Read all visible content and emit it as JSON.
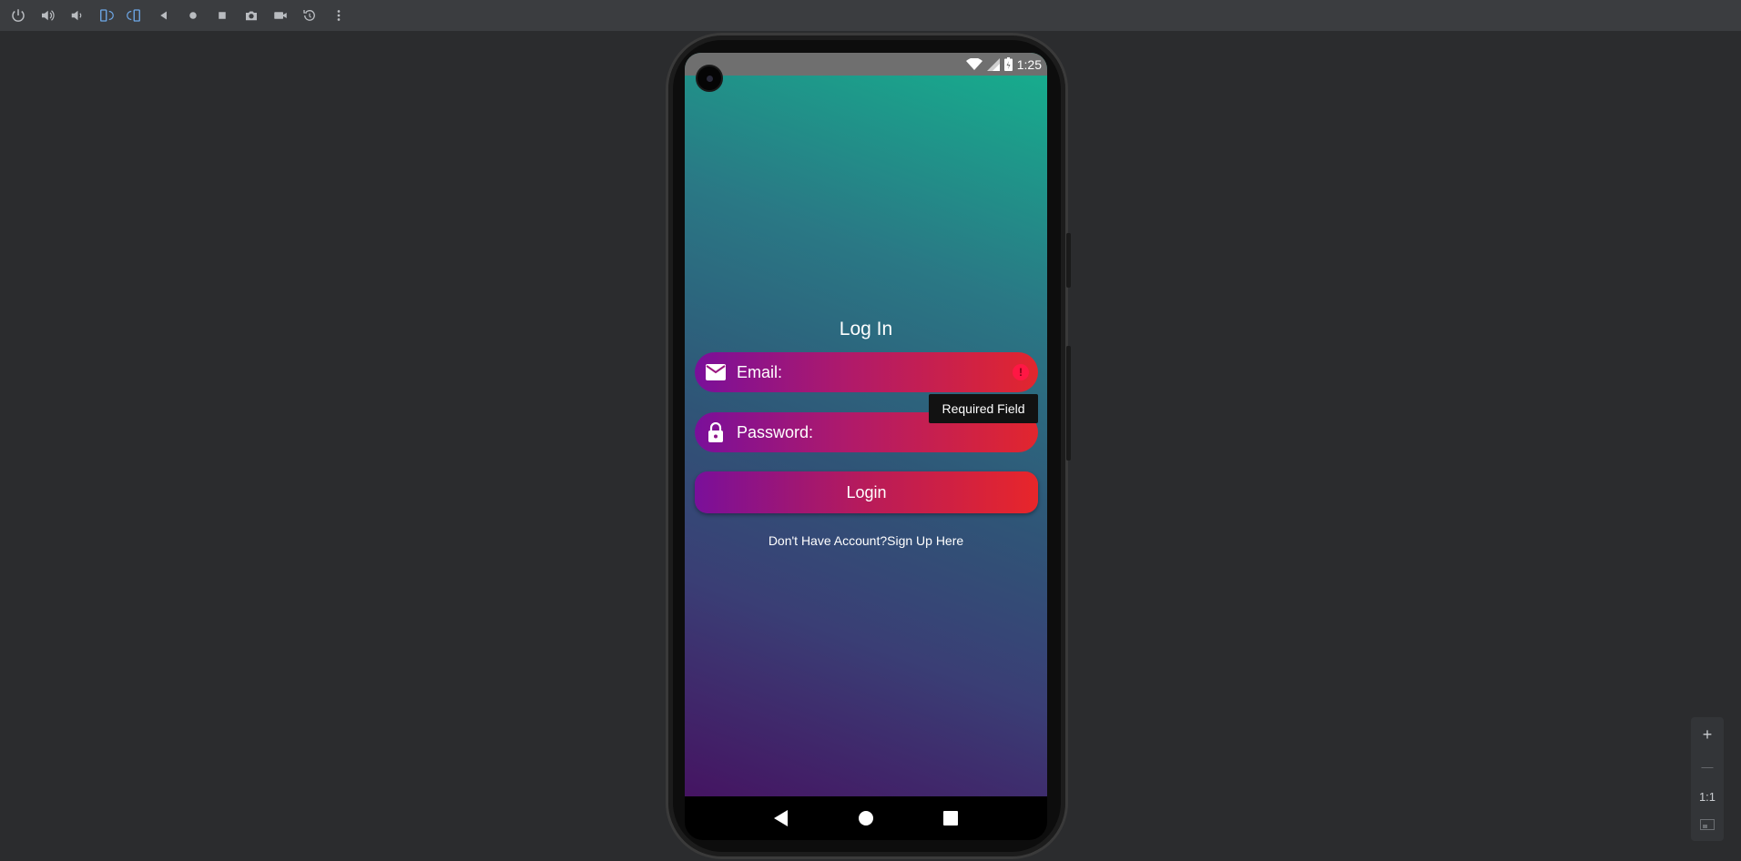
{
  "toolbar": {
    "icons": [
      "power-icon",
      "volume-up-icon",
      "volume-down-icon",
      "rotate-left-icon",
      "rotate-right-icon",
      "back-icon",
      "home-icon",
      "overview-icon",
      "screenshot-icon",
      "screenrecord-icon",
      "rewind-icon",
      "more-icon"
    ]
  },
  "status_bar": {
    "time": "1:25"
  },
  "login": {
    "title": "Log In",
    "email_label": "Email:",
    "email_error_icon": "!",
    "password_label": "Password:",
    "tooltip": "Required Field",
    "login_button": "Login",
    "no_account_text": "Don't Have Account?",
    "signup_link": "Sign Up Here"
  },
  "zoom_controls": {
    "plus": "+",
    "minus": "—",
    "one_to_one": "1:1"
  },
  "colors": {
    "accent_start": "#7a0f9a",
    "accent_end": "#e2262e",
    "error": "#ff1744"
  }
}
